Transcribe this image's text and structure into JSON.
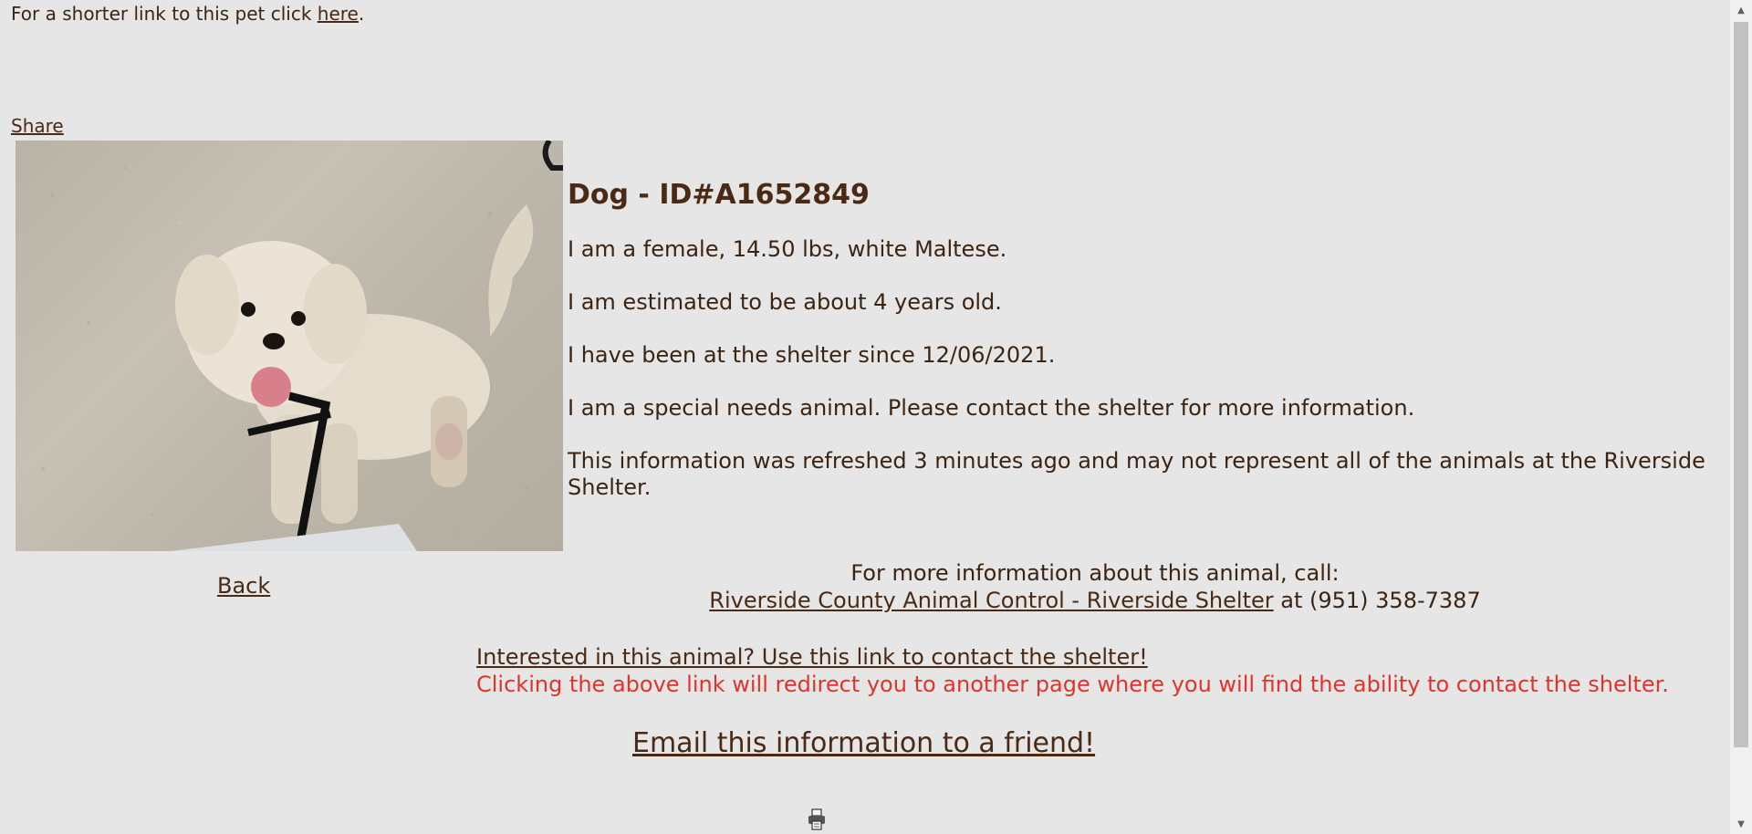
{
  "shortlink": {
    "prefix": "For a shorter link to this pet click ",
    "link": "here",
    "suffix": "."
  },
  "share": "Share",
  "animal": {
    "title": "Dog - ID#A1652849",
    "details": [
      "I am a female, 14.50 lbs, white Maltese.",
      "I am estimated to be about 4 years old.",
      "I have been at the shelter since 12/06/2021.",
      "I am a special needs animal. Please contact the shelter for more information.",
      "This information was refreshed 3 minutes ago and may not represent all of the animals at the Riverside Shelter."
    ]
  },
  "back": "Back",
  "contact": {
    "intro": "For more information about this animal, call:",
    "shelter_name": "Riverside County Animal Control - Riverside Shelter",
    "at": " at (951) 358-7387"
  },
  "interest_link": "Interested in this animal? Use this link to contact the shelter!",
  "redirect_note": "Clicking the above link will redirect you to another page where you will find the ability to contact the shelter.",
  "email_link": "Email this information to a friend!",
  "icons": {
    "printer": "printer-icon",
    "scroll_up": "scroll-up-arrow-icon",
    "scroll_down": "scroll-down-arrow-icon"
  },
  "colors": {
    "background": "#e6e6e6",
    "text": "#4a2a14",
    "warning": "#e0342b"
  }
}
